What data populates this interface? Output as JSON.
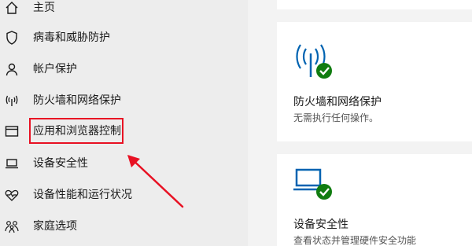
{
  "sidebar": {
    "items": [
      {
        "label": "主页",
        "icon": "home-icon"
      },
      {
        "label": "病毒和威胁防护",
        "icon": "shield-icon"
      },
      {
        "label": "帐户保护",
        "icon": "person-icon"
      },
      {
        "label": "防火墙和网络保护",
        "icon": "wifi-signal-icon"
      },
      {
        "label": "应用和浏览器控制",
        "icon": "browser-window-icon"
      },
      {
        "label": "设备安全性",
        "icon": "laptop-icon"
      },
      {
        "label": "设备性能和运行状况",
        "icon": "heart-pulse-icon"
      },
      {
        "label": "家庭选项",
        "icon": "family-icon"
      }
    ]
  },
  "cards": {
    "firewall": {
      "title": "防火墙和网络保护",
      "subtitle": "无需执行任何操作。",
      "icon": "antenna-icon"
    },
    "device": {
      "title": "设备安全性",
      "subtitle": "查看状态并管理硬件安全功能",
      "icon": "laptop-icon"
    }
  },
  "colors": {
    "accent": "#0063b1",
    "ok_green": "#107c10",
    "annotation_red": "#e81123"
  }
}
